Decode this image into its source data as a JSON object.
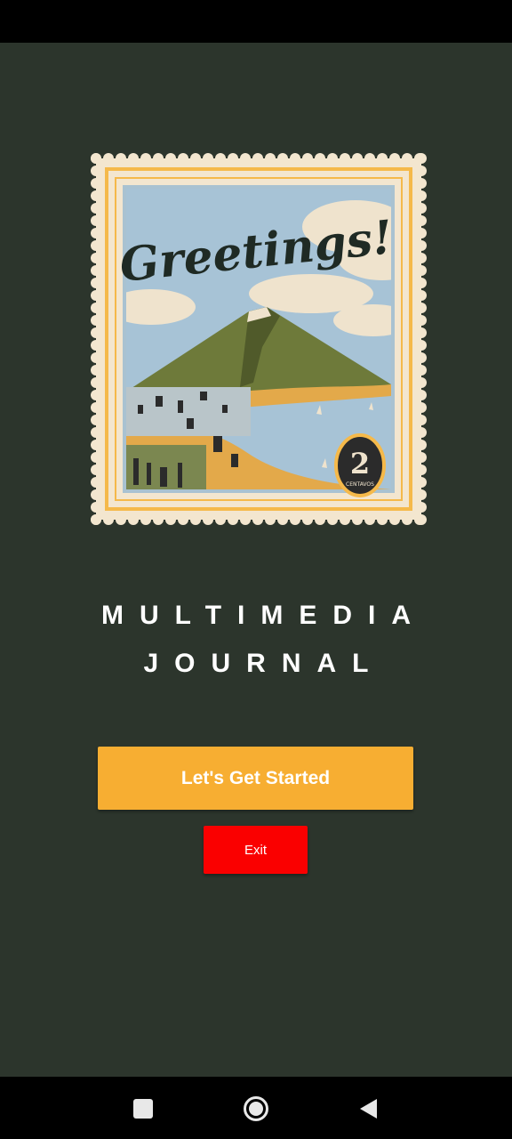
{
  "stamp": {
    "greeting": "Greetings!",
    "denomination": "2",
    "currency": "CENTAVOS"
  },
  "title": {
    "line1": "MULTIMEDIA",
    "line2": "JOURNAL"
  },
  "buttons": {
    "start_label": "Let's Get Started",
    "exit_label": "Exit"
  },
  "navigation": {
    "recents": "square-icon",
    "home": "circle-icon",
    "back": "triangle-back-icon"
  },
  "colors": {
    "background": "#2c352c",
    "start_button": "#f7ae32",
    "exit_button": "#fa0000"
  }
}
